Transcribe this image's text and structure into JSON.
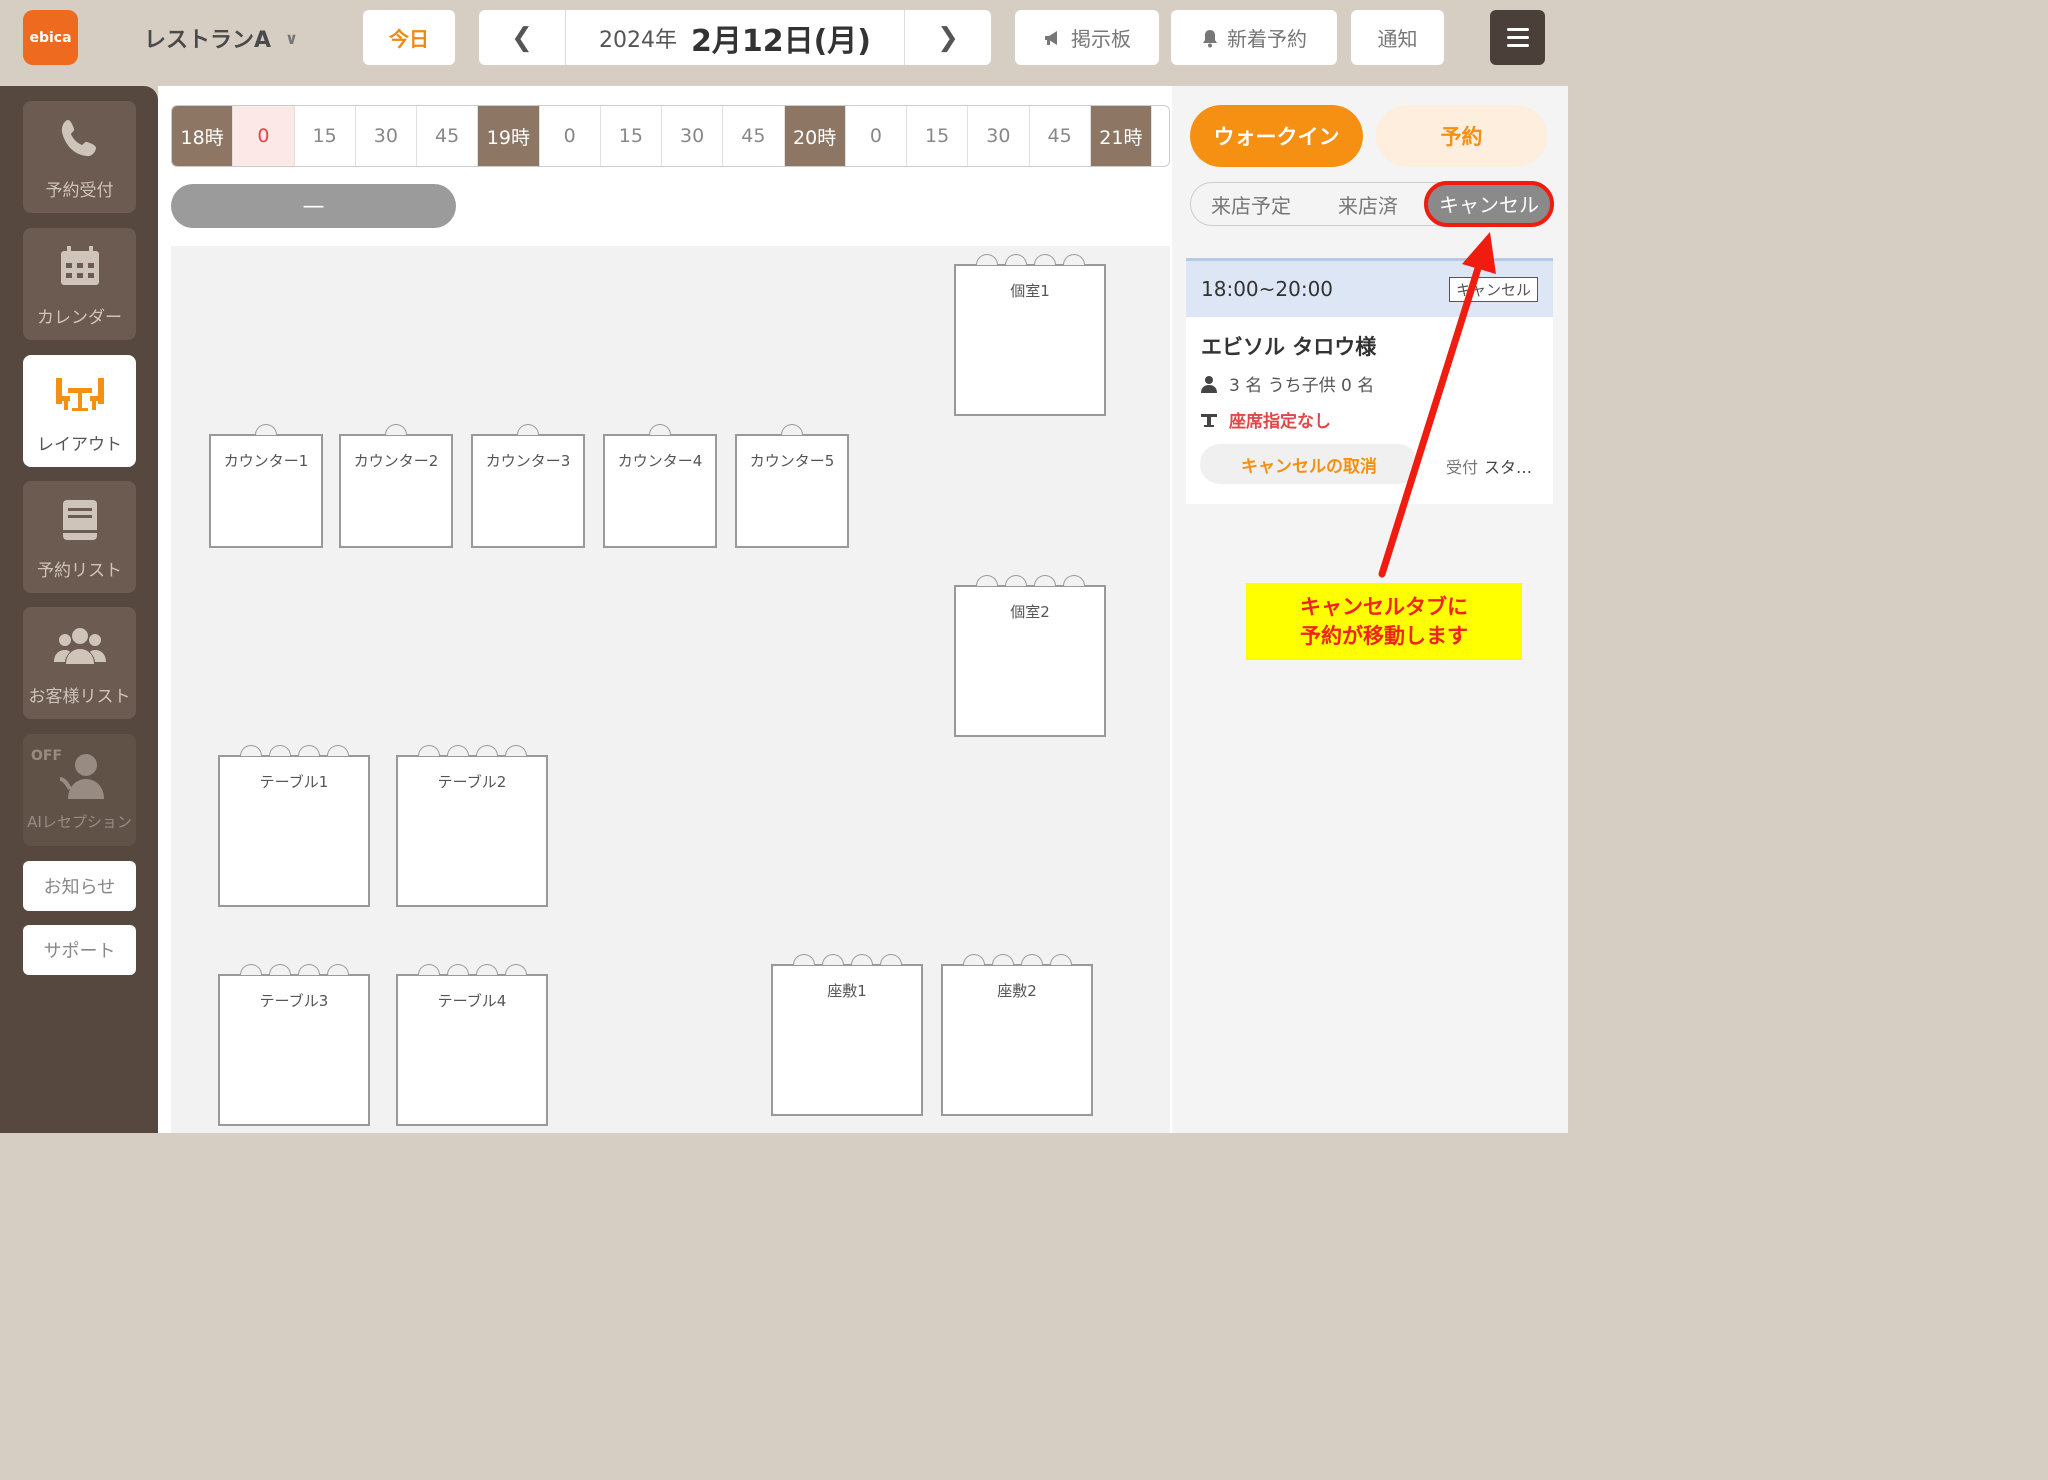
{
  "header": {
    "logo": "ebica",
    "store_name": "レストランA",
    "today": "今日",
    "date_year": "2024年",
    "date_main": "2月12日(月)",
    "board": "掲示板",
    "new_reservation": "新着予約",
    "notice": "通知"
  },
  "sidebar": {
    "items": [
      {
        "label": "予約受付",
        "icon": "phone-icon"
      },
      {
        "label": "カレンダー",
        "icon": "calendar-icon"
      },
      {
        "label": "レイアウト",
        "icon": "table-chairs-icon"
      },
      {
        "label": "予約リスト",
        "icon": "book-icon"
      },
      {
        "label": "お客様リスト",
        "icon": "people-icon"
      },
      {
        "label": "AIレセプション",
        "icon": "ai-receptionist-icon",
        "badge": "OFF"
      }
    ],
    "news": "お知らせ",
    "support": "サポート"
  },
  "timeline": [
    "18時",
    "0",
    "15",
    "30",
    "45",
    "19時",
    "0",
    "15",
    "30",
    "45",
    "20時",
    "0",
    "15",
    "30",
    "45",
    "21時"
  ],
  "filter_pill": "—",
  "tables": {
    "private1": "個室1",
    "private2": "個室2",
    "counter1": "カウンター1",
    "counter2": "カウンター2",
    "counter3": "カウンター3",
    "counter4": "カウンター4",
    "counter5": "カウンター5",
    "table1": "テーブル1",
    "table2": "テーブル2",
    "table3": "テーブル3",
    "table4": "テーブル4",
    "zashiki1": "座敷1",
    "zashiki2": "座敷2"
  },
  "right_panel": {
    "walkin": "ウォークイン",
    "reserve": "予約",
    "tabs": [
      "来店予定",
      "来店済",
      "キャンセル"
    ],
    "card": {
      "time": "18:00~20:00",
      "status": "キャンセル",
      "guest": "エビソル タロウ様",
      "people": "3 名 うち子供 0 名",
      "seat": "座席指定なし",
      "undo": "キャンセルの取消",
      "accept_label": "受付",
      "accept_value": "スタ…"
    }
  },
  "annotation": {
    "line1": "キャンセルタブに",
    "line2": "予約が移動します"
  },
  "colors": {
    "accent": "#f59012",
    "sidebar": "#56483f",
    "hour_cell": "#8d7764",
    "highlight": "#f01c10",
    "callout_bg": "#ffff00"
  }
}
